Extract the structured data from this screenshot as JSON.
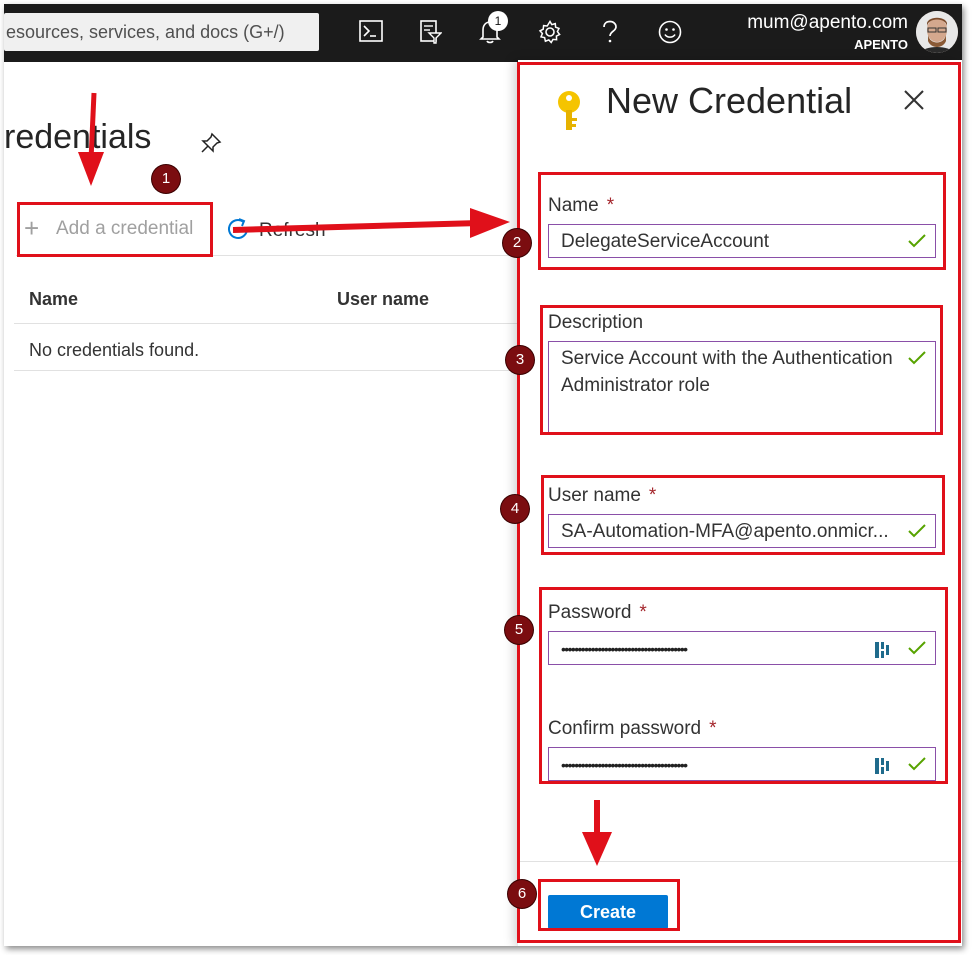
{
  "topbar": {
    "search_placeholder": "esources, services, and docs (G+/)",
    "notification_count": "1",
    "account_email": "mum@apento.com",
    "account_org": "APENTO",
    "icons": [
      "cloud-shell-icon",
      "directory-filter-icon",
      "bell-icon",
      "gear-icon",
      "help-icon",
      "feedback-icon"
    ]
  },
  "page": {
    "title": "redentials",
    "toolbar": {
      "add_label": "Add a credential",
      "refresh_label": "Refresh"
    },
    "table": {
      "columns": [
        "Name",
        "User name"
      ],
      "empty_message": "No credentials found."
    }
  },
  "panel": {
    "title": "New Credential",
    "fields": {
      "name": {
        "label": "Name",
        "required": "*",
        "value": "DelegateServiceAccount"
      },
      "description": {
        "label": "Description",
        "value": "Service Account with the Authentication Administrator role"
      },
      "username": {
        "label": "User name",
        "required": "*",
        "value": "SA-Automation-MFA@apento.onmicr..."
      },
      "password": {
        "label": "Password",
        "required": "*",
        "value": "••••••••••••••••••••••••••••••••••••••"
      },
      "confirm_password": {
        "label": "Confirm password",
        "required": "*",
        "value": "••••••••••••••••••••••••••••••••••••••"
      }
    },
    "create_label": "Create"
  },
  "annotations": {
    "markers": [
      "1",
      "2",
      "3",
      "4",
      "5",
      "6"
    ],
    "color": "#e0101a"
  }
}
